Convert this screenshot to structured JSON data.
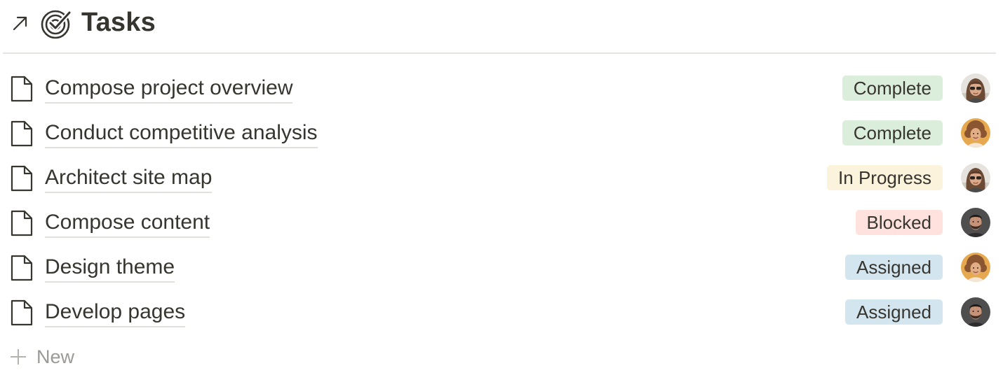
{
  "header": {
    "title": "Tasks",
    "open_icon": "arrow-up-right-icon",
    "title_icon": "target-check-icon"
  },
  "tasks": [
    {
      "title": "Compose project overview",
      "status": "Complete",
      "status_color": "#dbeddb",
      "assignee_avatar": "woman-sunglasses"
    },
    {
      "title": "Conduct competitive analysis",
      "status": "Complete",
      "status_color": "#dbeddb",
      "assignee_avatar": "woman-curly"
    },
    {
      "title": "Architect site map",
      "status": "In Progress",
      "status_color": "#fbf3db",
      "assignee_avatar": "woman-sunglasses"
    },
    {
      "title": "Compose content",
      "status": "Blocked",
      "status_color": "#ffe2dd",
      "assignee_avatar": "man-beard"
    },
    {
      "title": "Design theme",
      "status": "Assigned",
      "status_color": "#d3e5ef",
      "assignee_avatar": "woman-curly"
    },
    {
      "title": "Develop pages",
      "status": "Assigned",
      "status_color": "#d3e5ef",
      "assignee_avatar": "man-beard"
    }
  ],
  "new_row": {
    "label": "New",
    "icon": "plus-icon"
  },
  "colors": {
    "text": "#37352f",
    "muted": "#9b9a97",
    "complete": "#dbeddb",
    "in_progress": "#fbf3db",
    "blocked": "#ffe2dd",
    "assigned": "#d3e5ef"
  }
}
